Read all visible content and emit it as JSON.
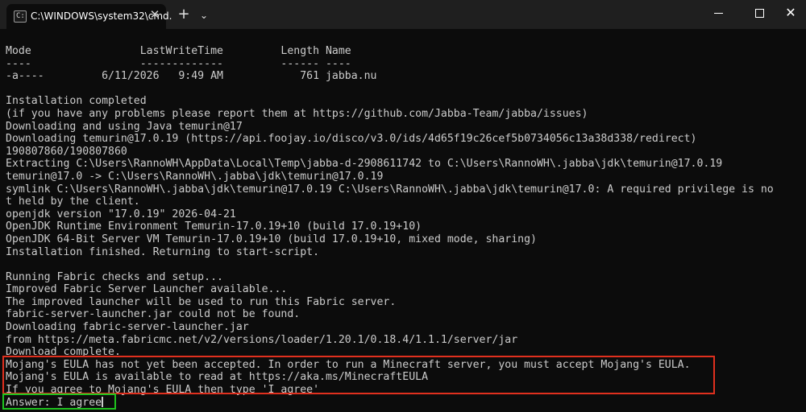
{
  "window": {
    "tab_title": "C:\\WINDOWS\\system32\\cmd.",
    "tab_icon": "cmd-icon",
    "close_tab_glyph": "✕",
    "new_tab_glyph": "+",
    "dropdown_glyph": "⌄",
    "minimize_icon": "minimize-icon",
    "maximize_icon": "maximize-icon",
    "close_glyph": "✕"
  },
  "console": {
    "lines": [
      "Mode                 LastWriteTime         Length Name",
      "----                 -------------         ------ ----",
      "-a----         6/11/2026   9:49 AM            761 jabba.nu",
      "",
      "Installation completed",
      "(if you have any problems please report them at https://github.com/Jabba-Team/jabba/issues)",
      "Downloading and using Java temurin@17",
      "Downloading temurin@17.0.19 (https://api.foojay.io/disco/v3.0/ids/4d65f19c26cef5b0734056c13a38d338/redirect)",
      "190807860/190807860",
      "Extracting C:\\Users\\RannoWH\\AppData\\Local\\Temp\\jabba-d-2908611742 to C:\\Users\\RannoWH\\.jabba\\jdk\\temurin@17.0.19",
      "temurin@17.0 -> C:\\Users\\RannoWH\\.jabba\\jdk\\temurin@17.0.19",
      "symlink C:\\Users\\RannoWH\\.jabba\\jdk\\temurin@17.0.19 C:\\Users\\RannoWH\\.jabba\\jdk\\temurin@17.0: A required privilege is no",
      "t held by the client.",
      "openjdk version \"17.0.19\" 2026-04-21",
      "OpenJDK Runtime Environment Temurin-17.0.19+10 (build 17.0.19+10)",
      "OpenJDK 64-Bit Server VM Temurin-17.0.19+10 (build 17.0.19+10, mixed mode, sharing)",
      "Installation finished. Returning to start-script.",
      "",
      "Running Fabric checks and setup...",
      "Improved Fabric Server Launcher available...",
      "The improved launcher will be used to run this Fabric server.",
      "fabric-server-launcher.jar could not be found.",
      "Downloading fabric-server-launcher.jar",
      "from https://meta.fabricmc.net/v2/versions/loader/1.20.1/0.18.4/1.1.1/server/jar",
      "Download complete.",
      "Mojang's EULA has not yet been accepted. In order to run a Minecraft server, you must accept Mojang's EULA.",
      "Mojang's EULA is available to read at https://aka.ms/MinecraftEULA",
      "If you agree to Mojang's EULA then type 'I agree'"
    ],
    "input_line": "Answer: I agree"
  },
  "colors": {
    "background": "#0c0c0c",
    "text": "#cccccc",
    "highlight_eula": "#e0301e",
    "highlight_answer": "#1fc41f"
  }
}
